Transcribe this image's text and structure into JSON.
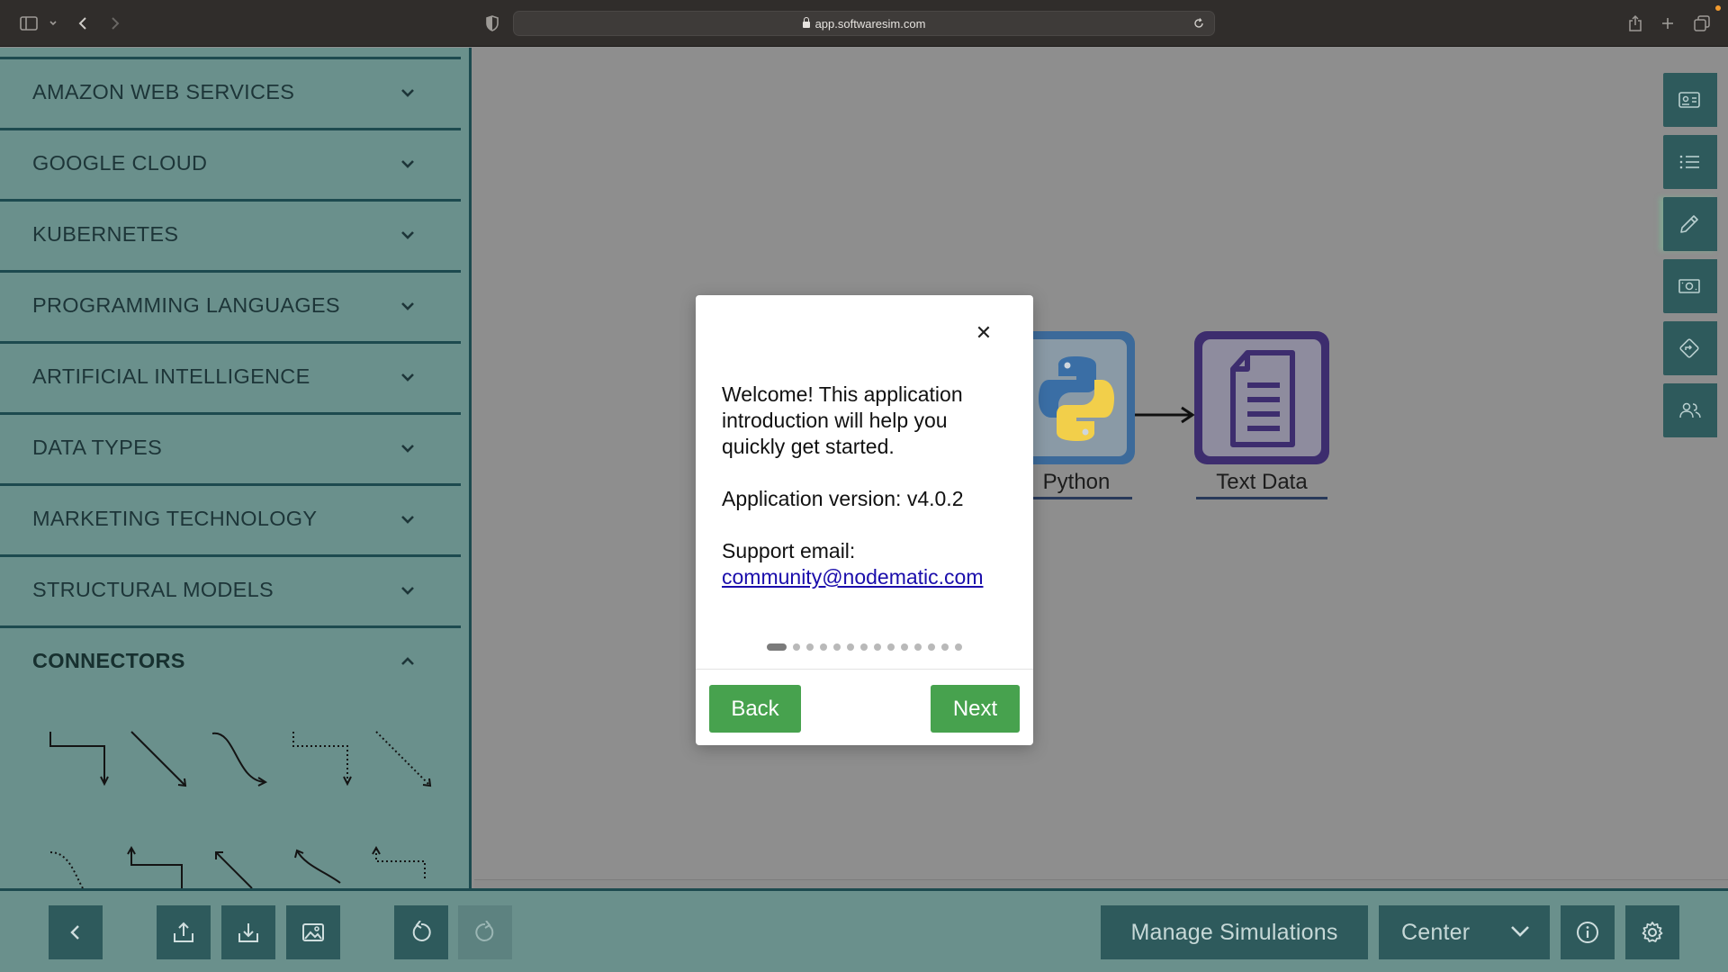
{
  "browser": {
    "url": "app.softwaresim.com"
  },
  "sidebar": {
    "categories": [
      {
        "label": "AMAZON WEB SERVICES",
        "expanded": false
      },
      {
        "label": "GOOGLE CLOUD",
        "expanded": false
      },
      {
        "label": "KUBERNETES",
        "expanded": false
      },
      {
        "label": "PROGRAMMING LANGUAGES",
        "expanded": false
      },
      {
        "label": "ARTIFICIAL INTELLIGENCE",
        "expanded": false
      },
      {
        "label": "DATA TYPES",
        "expanded": false
      },
      {
        "label": "MARKETING TECHNOLOGY",
        "expanded": false
      },
      {
        "label": "STRUCTURAL MODELS",
        "expanded": false
      },
      {
        "label": "CONNECTORS",
        "expanded": true
      }
    ],
    "connector_icons": [
      "elbow-arrow-icon",
      "straight-arrow-icon",
      "curved-arrow-icon",
      "dotted-elbow-arrow-icon",
      "dotted-straight-arrow-icon",
      "dotted-curved-arrow-icon",
      "elbow-up-arrow-icon",
      "straight-up-arrow-icon",
      "curved-up-arrow-icon",
      "dotted-elbow-up-arrow-icon"
    ]
  },
  "canvas": {
    "nodes": [
      {
        "label": "Python",
        "icon": "python-icon",
        "color": "#3c6a9a"
      },
      {
        "label": "Text Data",
        "icon": "document-icon",
        "color": "#3d2d6e"
      }
    ]
  },
  "modal": {
    "intro_text": "Welcome! This application introduction will help you quickly get started.",
    "version_text": "Application version: v4.0.2",
    "support_label": "Support email:",
    "support_email": "community@nodematic.com",
    "page_count": 14,
    "current_page": 1,
    "back_label": "Back",
    "next_label": "Next"
  },
  "bottom_bar": {
    "manage_label": "Manage Simulations",
    "center_label": "Center"
  },
  "colors": {
    "sidebar_bg": "#6a908c",
    "button_bg": "#2e5a5c",
    "accent_green": "#47a24e"
  }
}
